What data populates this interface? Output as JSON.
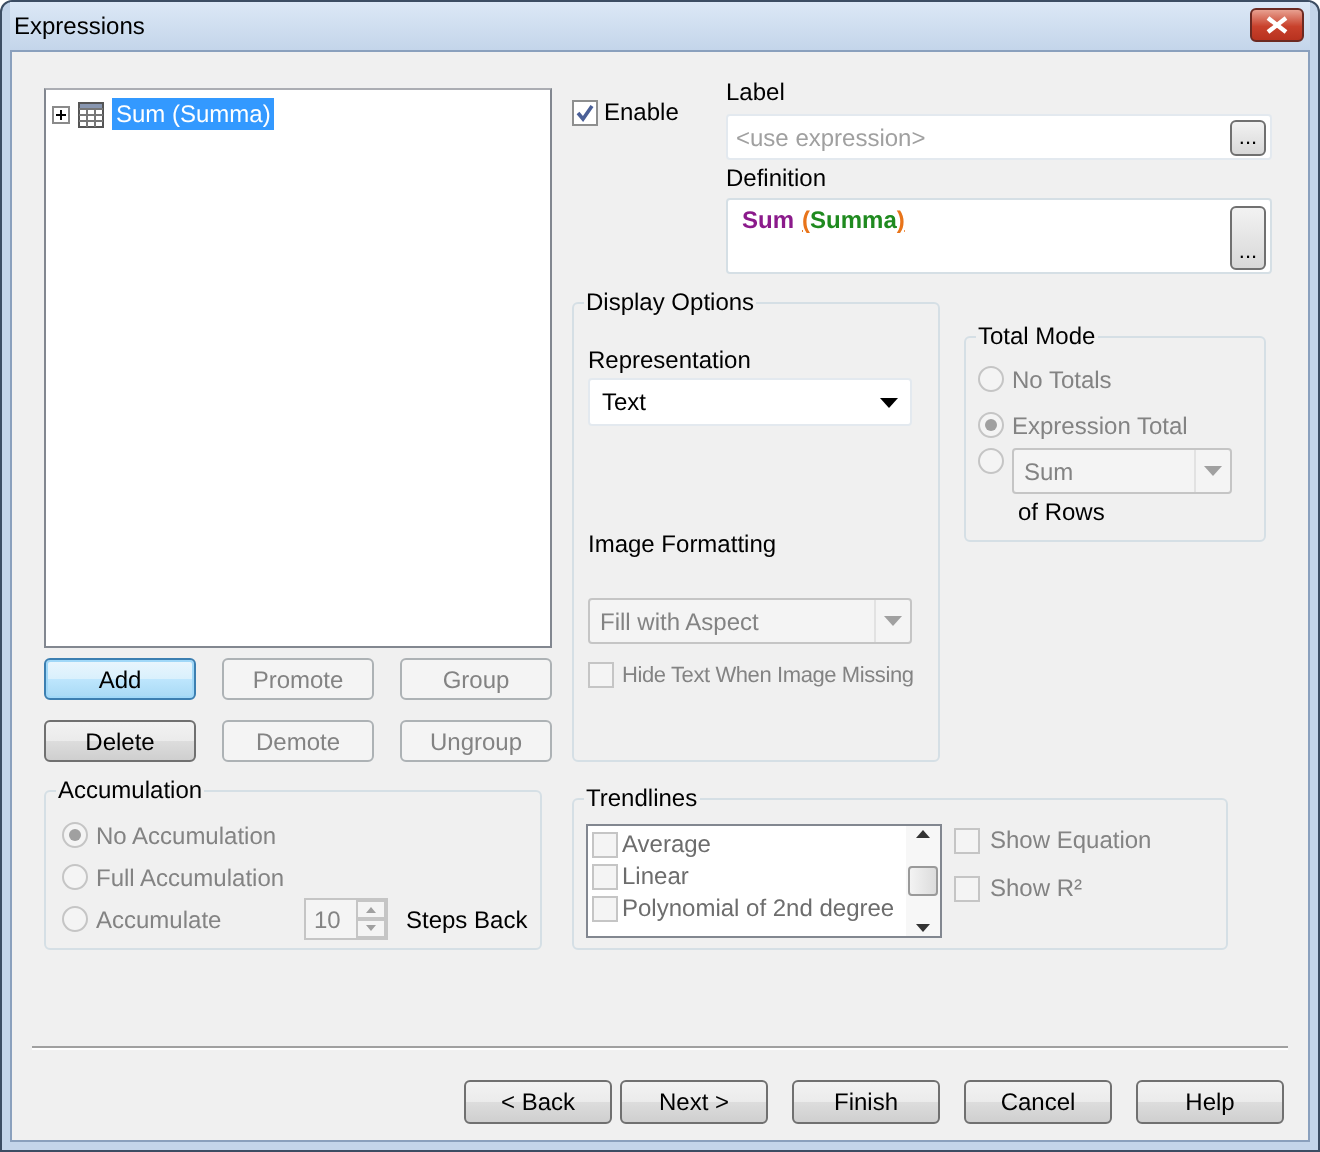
{
  "window": {
    "title": "Expressions"
  },
  "expression_tree": [
    {
      "label": "Sum (Summa)",
      "selected": true,
      "expanded": false
    }
  ],
  "tree_buttons": [
    [
      {
        "label": "Add",
        "disabled": false,
        "default": true
      },
      {
        "label": "Promote",
        "disabled": true,
        "default": false
      },
      {
        "label": "Group",
        "disabled": true,
        "default": false
      }
    ],
    [
      {
        "label": "Delete",
        "disabled": false,
        "default": false
      },
      {
        "label": "Demote",
        "disabled": true,
        "default": false
      },
      {
        "label": "Ungroup",
        "disabled": true,
        "default": false
      }
    ]
  ],
  "accumulation": {
    "title": "Accumulation",
    "disabled": true,
    "options": [
      {
        "kind": "plain",
        "label": "No Accumulation",
        "selected": true
      },
      {
        "kind": "plain",
        "label": "Full Accumulation",
        "selected": false
      },
      {
        "kind": "steps",
        "label": "Accumulate",
        "selected": false,
        "value": "10",
        "suffix": "Steps Back"
      }
    ]
  },
  "enable": {
    "label": "Enable",
    "checked": true
  },
  "label_field": {
    "caption": "Label",
    "placeholder": "<use expression>",
    "button": "..."
  },
  "definition": {
    "caption": "Definition",
    "button": "...",
    "tokens": [
      {
        "kind": "function",
        "text": "Sum"
      },
      {
        "kind": "paren",
        "text": "("
      },
      {
        "kind": "field",
        "text": "Summa"
      },
      {
        "kind": "paren",
        "text": ")"
      }
    ]
  },
  "display_options": {
    "title": "Display Options",
    "representation": {
      "caption": "Representation",
      "value": "Text",
      "disabled": false
    },
    "image_formatting": {
      "caption": "Image Formatting",
      "value": "Fill with Aspect",
      "disabled": true
    },
    "hide_text": {
      "label": "Hide Text When Image Missing",
      "checked": false,
      "disabled": true
    }
  },
  "total_mode": {
    "title": "Total Mode",
    "disabled": true,
    "options": [
      {
        "kind": "plain",
        "label": "No Totals",
        "selected": false
      },
      {
        "kind": "plain",
        "label": "Expression Total",
        "selected": true
      },
      {
        "kind": "dropdown",
        "value": "Sum",
        "suffix": "of Rows",
        "selected": false
      }
    ]
  },
  "trendlines": {
    "title": "Trendlines",
    "items": [
      {
        "label": "Average",
        "checked": false
      },
      {
        "label": "Linear",
        "checked": false
      },
      {
        "label": "Polynomial of 2nd degree",
        "checked": false
      }
    ],
    "show_equation": {
      "label": "Show Equation",
      "checked": false,
      "disabled": true
    },
    "show_r2": {
      "label": "Show R²",
      "checked": false,
      "disabled": true
    }
  },
  "footer_buttons": [
    {
      "label": "< Back"
    },
    {
      "label": "Next >"
    },
    {
      "label": "Finish"
    },
    {
      "label": "Cancel"
    },
    {
      "label": "Help"
    }
  ]
}
